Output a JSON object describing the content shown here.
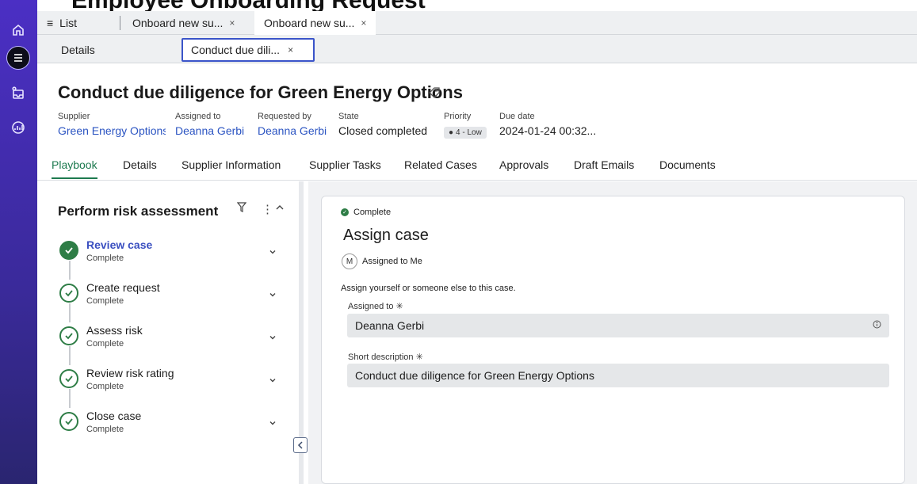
{
  "heading_cut": "Employee Onboarding Request",
  "tabs": [
    {
      "label": "List",
      "closable": false
    },
    {
      "label": "Onboard new su...",
      "closable": true
    },
    {
      "label": "Onboard new su...",
      "closable": true
    }
  ],
  "subtabs": [
    {
      "label": "Details"
    },
    {
      "label": "Conduct due dili..."
    }
  ],
  "close_glyph": "×",
  "record": {
    "title": "Conduct due diligence for Green Energy Options",
    "fields": {
      "supplier_label": "Supplier",
      "supplier_value": "Green Energy Options",
      "assigned_label": "Assigned to",
      "assigned_value": "Deanna Gerbi",
      "requested_label": "Requested by",
      "requested_value": "Deanna Gerbi",
      "state_label": "State",
      "state_value": "Closed completed",
      "priority_label": "Priority",
      "priority_value": "4 - Low",
      "due_label": "Due date",
      "due_value": "2024-01-24 00:32..."
    }
  },
  "record_tabs": [
    "Playbook",
    "Details",
    "Supplier Information",
    "Supplier Tasks",
    "Related Cases",
    "Approvals",
    "Draft Emails",
    "Documents"
  ],
  "playbook": {
    "title": "Perform risk assessment",
    "steps": [
      {
        "name": "Review case",
        "status": "Complete"
      },
      {
        "name": "Create request",
        "status": "Complete"
      },
      {
        "name": "Assess risk",
        "status": "Complete"
      },
      {
        "name": "Review risk rating",
        "status": "Complete"
      },
      {
        "name": "Close case",
        "status": "Complete"
      }
    ]
  },
  "activity": {
    "status": "Complete",
    "title": "Assign case",
    "avatar_initial": "M",
    "assigned_me": "Assigned to Me",
    "instruction": "Assign yourself or someone else to this case.",
    "assigned_label": "Assigned to",
    "assigned_value": "Deanna Gerbi",
    "short_desc_label": "Short description",
    "short_desc_value": "Conduct due diligence for Green Energy Options",
    "required_mark": "✳"
  },
  "colors": {
    "rail": "#4b2fc4",
    "accent_link": "#2b54c2",
    "playbook_green": "#2e7d46",
    "active_subtab_border": "#3a54c9"
  }
}
